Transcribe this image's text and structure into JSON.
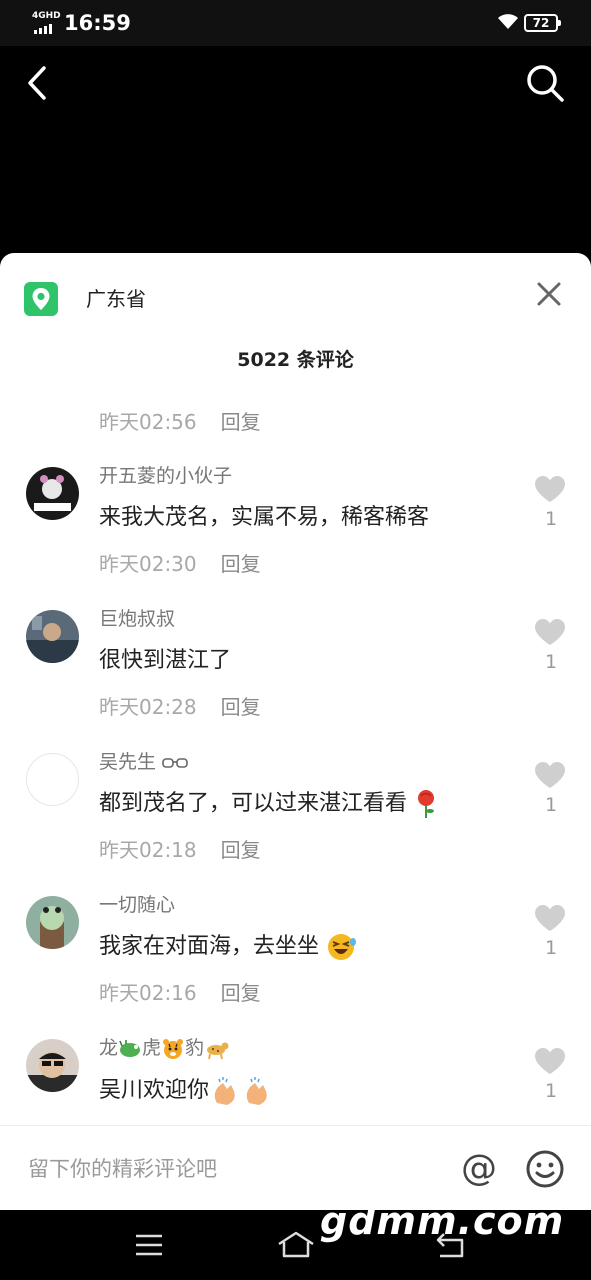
{
  "status_bar": {
    "network": "4GHD",
    "time": "16:59",
    "battery": "72"
  },
  "location": {
    "name": "广东省"
  },
  "comment_count": "5022 条评论",
  "reply_label": "回复",
  "top_meta": {
    "time": "昨天02:56"
  },
  "comments": [
    {
      "user": "开五菱的小伙子",
      "text": "来我大茂名，实属不易，稀客稀客",
      "time": "昨天02:30",
      "likes": "1"
    },
    {
      "user": "巨炮叔叔",
      "text": "很快到湛江了",
      "time": "昨天02:28",
      "likes": "1"
    },
    {
      "user": "吴先生",
      "text": "都到茂名了，可以过来湛江看看",
      "time": "昨天02:18",
      "likes": "1"
    },
    {
      "user": "一切随心",
      "text": "我家在对面海，去坐坐",
      "time": "昨天02:16",
      "likes": "1"
    },
    {
      "user_parts": [
        "龙",
        "虎",
        "豹"
      ],
      "text": "吴川欢迎你",
      "likes": "1"
    }
  ],
  "input": {
    "placeholder": "留下你的精彩评论吧",
    "at_symbol": "@"
  },
  "watermark": "gdmm.com",
  "colors": {
    "location_green": "#2fc36a",
    "like_gray": "#cfcfcf",
    "sheet_bg": "#ffffff"
  }
}
